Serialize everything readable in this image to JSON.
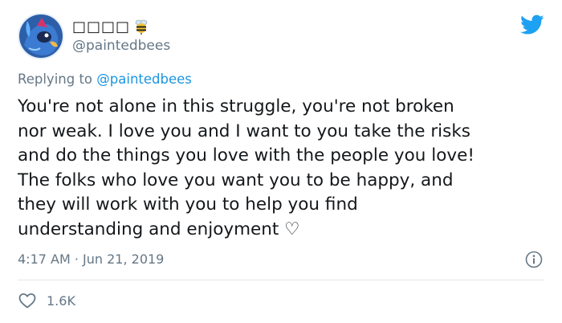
{
  "user": {
    "display_name": "□□□□",
    "handle": "@paintedbees",
    "avatar_icon": "avatar-illustration",
    "name_emoji": "bee-icon"
  },
  "reply": {
    "prefix": "Replying to ",
    "mention": "@paintedbees"
  },
  "tweet": {
    "text": "You're not alone in this struggle, you're not broken\nnor weak. I love you and I want to you take the risks\nand do the things you love with the people you love!\nThe folks who love you want you to be happy, and\nthey will work with you to help you find\nunderstanding and enjoyment ♡",
    "timestamp": "4:17 AM · Jun 21, 2019"
  },
  "actions": {
    "like_count": "1.6K"
  },
  "colors": {
    "twitter_blue": "#1da1f2",
    "mention": "#1b95e0",
    "secondary_text": "#657786",
    "divider": "#e1e8ed"
  },
  "icons": {
    "logo": "twitter-bird-icon",
    "info": "info-icon",
    "like": "heart-icon"
  }
}
